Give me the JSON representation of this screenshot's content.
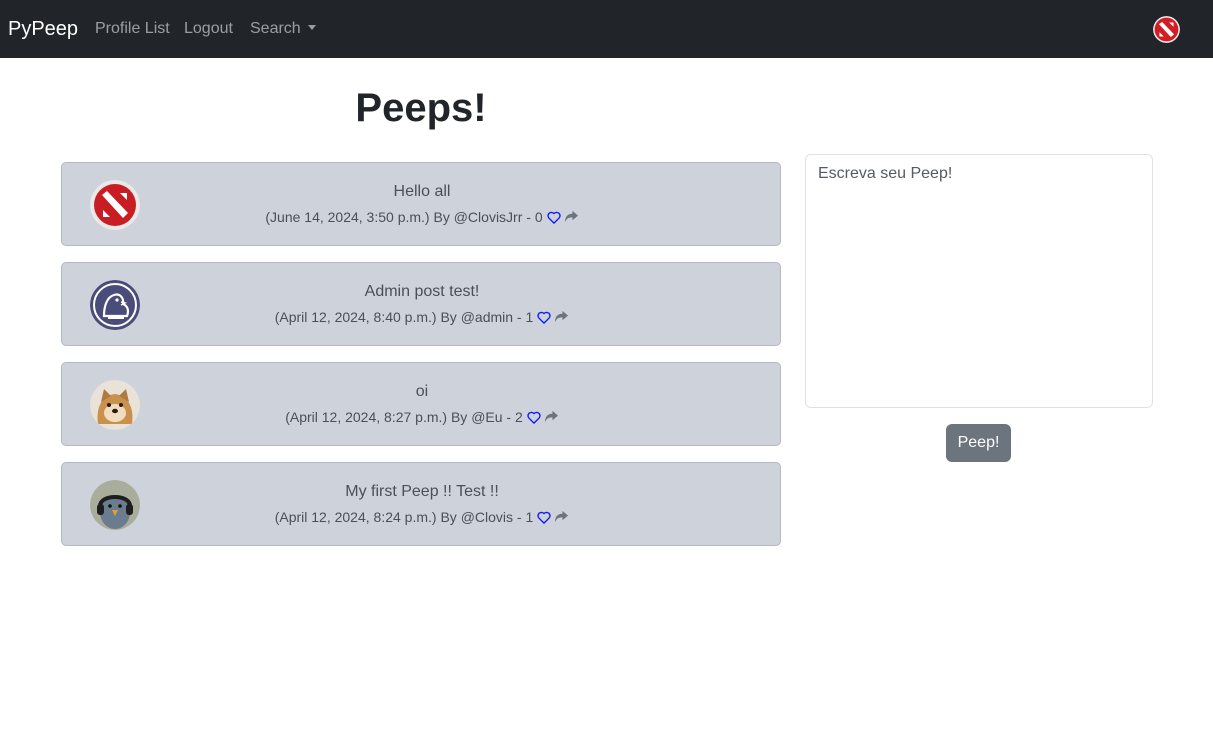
{
  "navbar": {
    "brand": "PyPeep",
    "links": [
      "Profile List",
      "Logout"
    ],
    "search_label": "Search"
  },
  "main": {
    "title": "Peeps!"
  },
  "peeps": [
    {
      "text": "Hello all",
      "date": "(June 14, 2024, 3:50 p.m.)",
      "author": "@ClovisJrr",
      "likes": "0",
      "avatar": "red-shield-logo"
    },
    {
      "text": "Admin post test!",
      "date": "(April 12, 2024, 8:40 p.m.)",
      "author": "@admin",
      "likes": "1",
      "avatar": "peep-bird-logo"
    },
    {
      "text": "oi",
      "date": "(April 12, 2024, 8:27 p.m.)",
      "author": "@Eu",
      "likes": "2",
      "avatar": "dog-photo"
    },
    {
      "text": "My first Peep !! Test !!",
      "date": "(April 12, 2024, 8:24 p.m.)",
      "author": "@Clovis",
      "likes": "1",
      "avatar": "bird-with-headphones-photo"
    }
  ],
  "composer": {
    "placeholder": "Escreva seu Peep!",
    "button_label": "Peep!"
  },
  "colors": {
    "navbar_bg": "#212529",
    "card_bg": "#ced3db",
    "heart": "#0d1bff",
    "button_bg": "#6c757d"
  }
}
